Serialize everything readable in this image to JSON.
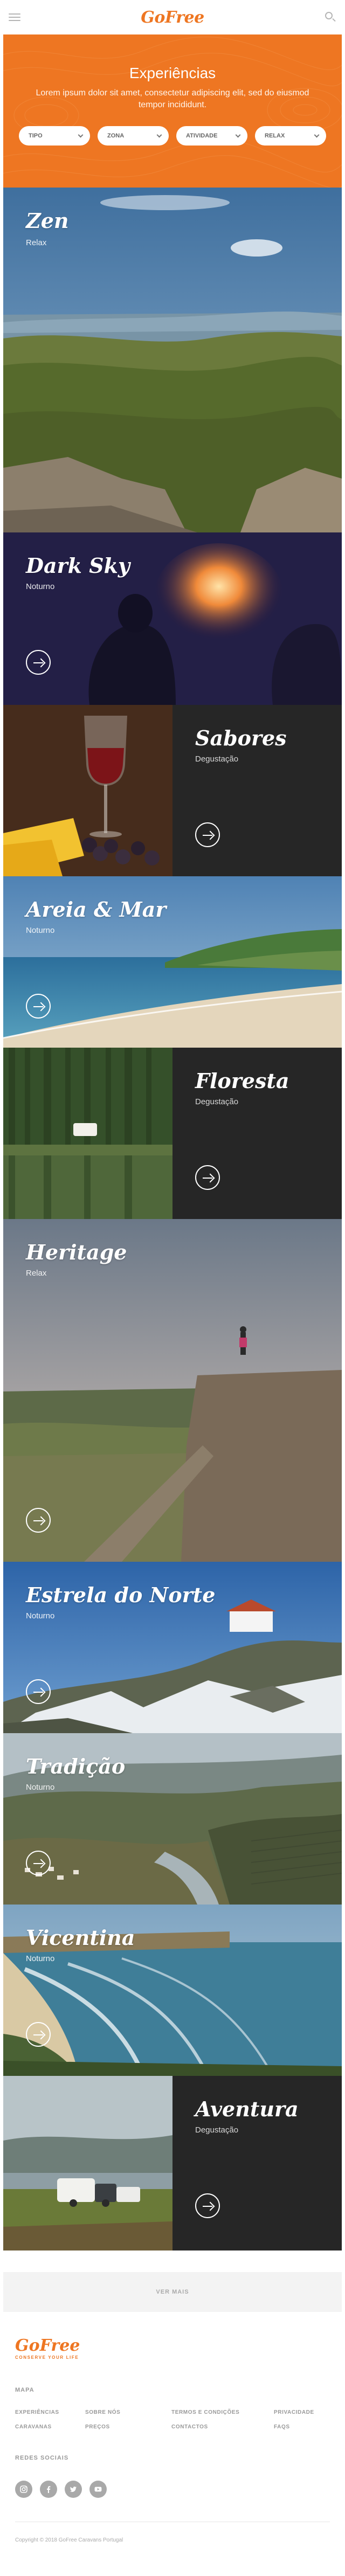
{
  "header": {
    "logo": "GoFree",
    "menu_icon": "hamburger-menu-icon",
    "search_icon": "search-icon"
  },
  "hero": {
    "title": "Experiências",
    "description": "Lorem ipsum dolor sit amet, consectetur adipiscing elit, sed do eiusmod tempor incididunt.",
    "background": "#ee7622",
    "filters": [
      {
        "label": "TIPO"
      },
      {
        "label": "ZONA"
      },
      {
        "label": "ATIVIDADE"
      },
      {
        "label": "RELAX"
      }
    ]
  },
  "experiences": [
    {
      "title": "Zen",
      "category": "Relax"
    },
    {
      "title": "Dark Sky",
      "category": "Noturno"
    },
    {
      "title": "Sabores",
      "category": "Degustação"
    },
    {
      "title": "Areia & Mar",
      "category": "Noturno"
    },
    {
      "title": "Floresta",
      "category": "Degustação"
    },
    {
      "title": "Heritage",
      "category": "Relax"
    },
    {
      "title": "Estrela do Norte",
      "category": "Noturno"
    },
    {
      "title": "Tradição",
      "category": "Noturno"
    },
    {
      "title": "Vicentina",
      "category": "Noturno"
    },
    {
      "title": "Aventura",
      "category": "Degustação"
    }
  ],
  "more_button": "VER MAIS",
  "footer": {
    "logo": "GoFree",
    "tagline": "CONSERVE YOUR LIFE",
    "menu_heading": "MAPA",
    "links": [
      "EXPERIÊNCIAS",
      "SOBRE NÓS",
      "TERMOS E CONDIÇÕES",
      "PRIVACIDADE",
      "CARAVANAS",
      "PREÇOS",
      "CONTACTOS",
      "FAQS"
    ],
    "social_heading": "REDES SOCIAIS",
    "socials": [
      "instagram-icon",
      "facebook-icon",
      "twitter-icon",
      "youtube-icon"
    ],
    "copyright": "Copyright © 2018 GoFree Caravans Portugal"
  },
  "colors": {
    "accent": "#ee7622",
    "dark_panel": "#262626"
  }
}
